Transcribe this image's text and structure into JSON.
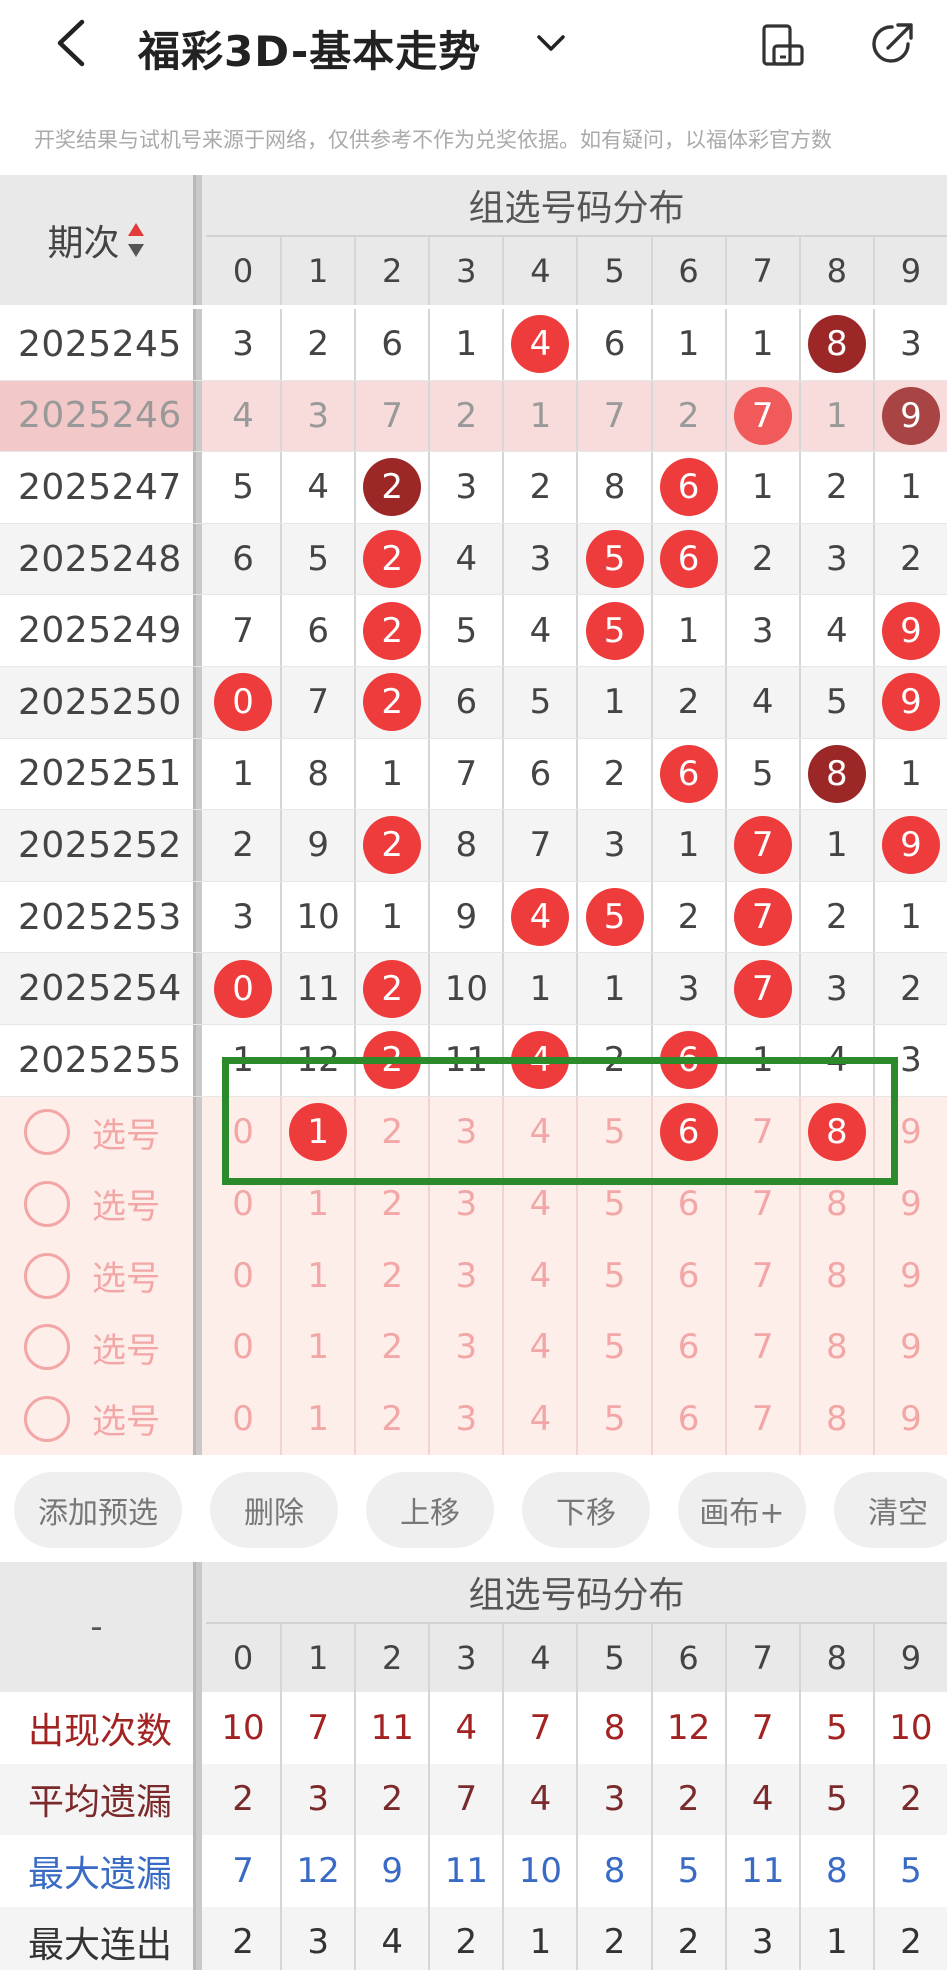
{
  "header": {
    "title": "福彩3D-基本走势",
    "notice": "开奖结果与试机号来源于网络，仅供参考不作为兑奖依据。如有疑问，以福体彩官方数"
  },
  "table": {
    "issue_label": "期次",
    "group_title": "组选号码分布",
    "digits": [
      "0",
      "1",
      "2",
      "3",
      "4",
      "5",
      "6",
      "7",
      "8",
      "9"
    ],
    "rows": [
      {
        "issue": "2025245",
        "cells": [
          "3",
          "2",
          "6",
          "1",
          "4",
          "6",
          "1",
          "1",
          "8",
          "3"
        ],
        "balls": [
          4,
          8
        ],
        "dark": [
          8
        ]
      },
      {
        "issue": "2025246",
        "cells": [
          "4",
          "3",
          "7",
          "2",
          "1",
          "7",
          "2",
          "7",
          "1",
          "9"
        ],
        "balls": [
          7,
          9
        ],
        "dark": [
          9
        ],
        "highlight": true
      },
      {
        "issue": "2025247",
        "cells": [
          "5",
          "4",
          "2",
          "3",
          "2",
          "8",
          "6",
          "1",
          "2",
          "1"
        ],
        "balls": [
          2,
          6
        ],
        "dark": [
          2
        ]
      },
      {
        "issue": "2025248",
        "cells": [
          "6",
          "5",
          "2",
          "4",
          "3",
          "5",
          "6",
          "2",
          "3",
          "2"
        ],
        "balls": [
          2,
          5,
          6
        ],
        "dark": []
      },
      {
        "issue": "2025249",
        "cells": [
          "7",
          "6",
          "2",
          "5",
          "4",
          "5",
          "1",
          "3",
          "4",
          "9"
        ],
        "balls": [
          2,
          5,
          9
        ],
        "dark": []
      },
      {
        "issue": "2025250",
        "cells": [
          "0",
          "7",
          "2",
          "6",
          "5",
          "1",
          "2",
          "4",
          "5",
          "9"
        ],
        "balls": [
          0,
          2,
          9
        ],
        "dark": []
      },
      {
        "issue": "2025251",
        "cells": [
          "1",
          "8",
          "1",
          "7",
          "6",
          "2",
          "6",
          "5",
          "8",
          "1"
        ],
        "balls": [
          6,
          8
        ],
        "dark": [
          8
        ]
      },
      {
        "issue": "2025252",
        "cells": [
          "2",
          "9",
          "2",
          "8",
          "7",
          "3",
          "1",
          "7",
          "1",
          "9"
        ],
        "balls": [
          2,
          7,
          9
        ],
        "dark": []
      },
      {
        "issue": "2025253",
        "cells": [
          "3",
          "10",
          "1",
          "9",
          "4",
          "5",
          "2",
          "7",
          "2",
          "1"
        ],
        "balls": [
          4,
          5,
          7
        ],
        "dark": []
      },
      {
        "issue": "2025254",
        "cells": [
          "0",
          "11",
          "2",
          "10",
          "1",
          "1",
          "3",
          "7",
          "3",
          "2"
        ],
        "balls": [
          0,
          2,
          7
        ],
        "dark": []
      },
      {
        "issue": "2025255",
        "cells": [
          "1",
          "12",
          "2",
          "11",
          "4",
          "2",
          "6",
          "1",
          "4",
          "3"
        ],
        "balls": [
          2,
          4,
          6
        ],
        "dark": []
      }
    ],
    "pick_label": "选号",
    "pick_rows": [
      {
        "balls": [
          1,
          6,
          8
        ]
      },
      {
        "balls": []
      },
      {
        "balls": []
      },
      {
        "balls": []
      },
      {
        "balls": []
      }
    ]
  },
  "buttons": [
    "添加预选",
    "删除",
    "上移",
    "下移",
    "画布+",
    "清空"
  ],
  "stats": {
    "dash": "-",
    "group_title": "组选号码分布",
    "digits": [
      "0",
      "1",
      "2",
      "3",
      "4",
      "5",
      "6",
      "7",
      "8",
      "9"
    ],
    "rows": [
      {
        "label": "出现次数",
        "values": [
          "10",
          "7",
          "11",
          "4",
          "7",
          "8",
          "12",
          "7",
          "5",
          "10"
        ],
        "color": "#a32222"
      },
      {
        "label": "平均遗漏",
        "values": [
          "2",
          "3",
          "2",
          "7",
          "4",
          "3",
          "2",
          "4",
          "5",
          "2"
        ],
        "color": "#7a2a2a"
      },
      {
        "label": "最大遗漏",
        "values": [
          "7",
          "12",
          "9",
          "11",
          "10",
          "8",
          "5",
          "11",
          "8",
          "5"
        ],
        "color": "#3a6bc4"
      },
      {
        "label": "最大连出",
        "values": [
          "2",
          "3",
          "4",
          "2",
          "1",
          "2",
          "2",
          "3",
          "1",
          "2"
        ],
        "color": "#333333"
      }
    ]
  },
  "colors": {
    "ball_red": "#ee3b3b",
    "ball_dark": "#9b2727",
    "pick_bg": "#fdeeea",
    "highlight_bg": "#f8dcdc",
    "selection_box": "#2b8b2b"
  }
}
